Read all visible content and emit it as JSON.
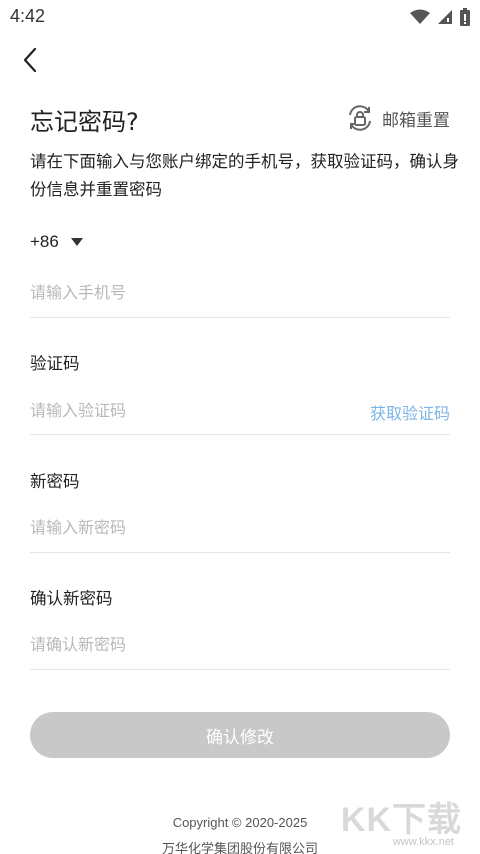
{
  "status_bar": {
    "time": "4:42"
  },
  "header": {
    "title": "忘记密码?",
    "email_reset_label": "邮箱重置"
  },
  "description": "请在下面输入与您账户绑定的手机号，获取验证码，确认身份信息并重置密码",
  "phone": {
    "country_code": "+86",
    "placeholder": "请输入手机号"
  },
  "verification": {
    "label": "验证码",
    "placeholder": "请输入验证码",
    "get_code_label": "获取验证码"
  },
  "new_password": {
    "label": "新密码",
    "placeholder": "请输入新密码"
  },
  "confirm_password": {
    "label": "确认新密码",
    "placeholder": "请确认新密码"
  },
  "submit_label": "确认修改",
  "footer": {
    "copyright": "Copyright © 2020-2025",
    "company": "万华化学集团股份有限公司"
  },
  "watermark": {
    "text": "KK下载",
    "url": "www.kkx.net"
  },
  "colors": {
    "link": "#7db4e6",
    "button_disabled": "#c8c8c8",
    "placeholder": "#b8b8b8"
  }
}
